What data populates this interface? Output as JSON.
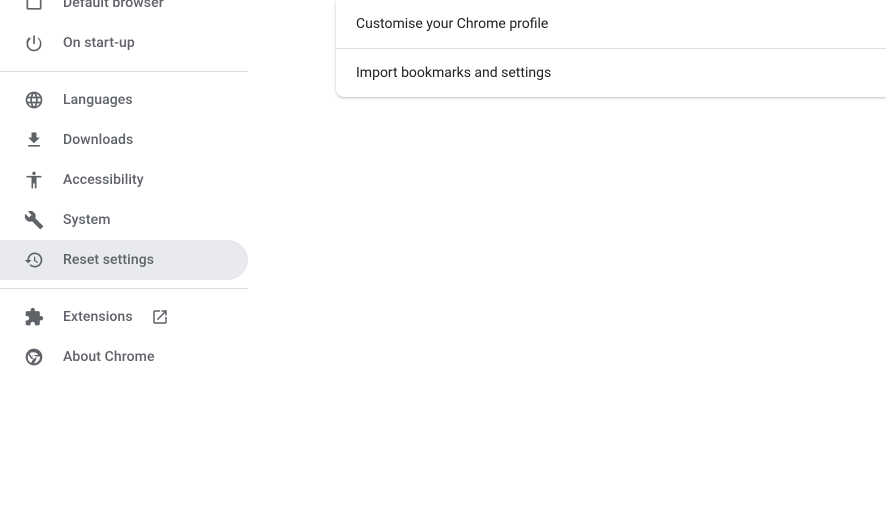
{
  "sidebar": {
    "items": [
      {
        "label": "Default browser"
      },
      {
        "label": "On start-up"
      },
      {
        "label": "Languages"
      },
      {
        "label": "Downloads"
      },
      {
        "label": "Accessibility"
      },
      {
        "label": "System"
      },
      {
        "label": "Reset settings"
      },
      {
        "label": "Extensions"
      },
      {
        "label": "About Chrome"
      }
    ]
  },
  "main": {
    "rows": [
      {
        "label": "Customise your Chrome profile"
      },
      {
        "label": "Import bookmarks and settings"
      }
    ]
  }
}
